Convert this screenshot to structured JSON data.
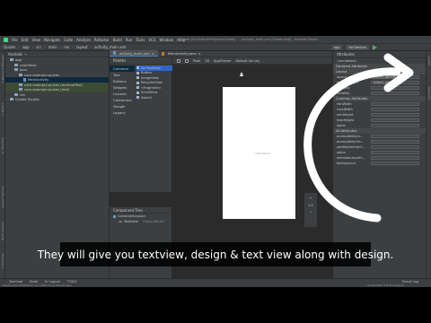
{
  "menubar": {
    "items": [
      "File",
      "Edit",
      "View",
      "Navigate",
      "Code",
      "Analyze",
      "Refactor",
      "Build",
      "Run",
      "Tools",
      "VCS",
      "Window",
      "Help"
    ],
    "window_title": "Quizes [D:\\Android Projects\\Quizes] - ...\\activity_main.xml [Quizes.app] - Android Studio"
  },
  "navbar": {
    "crumbs": [
      "Quizes",
      "app",
      "src",
      "main",
      "res",
      "layout",
      "activity_main.xml"
    ],
    "run_config": "app",
    "device": "No Devices",
    "zoom_value": "",
    "app_theme": "AppTheme",
    "default_label": "Default (en-us)"
  },
  "project": {
    "title": "Android",
    "rows": [
      {
        "label": "app",
        "indent": 1,
        "kind": "folder"
      },
      {
        "label": "manifests",
        "indent": 2,
        "kind": "folder"
      },
      {
        "label": "java",
        "indent": 2,
        "kind": "folder"
      },
      {
        "label": "com.example.quizes",
        "indent": 3,
        "kind": "folder"
      },
      {
        "label": "MainActivity",
        "indent": 4,
        "kind": "file",
        "selected": true
      },
      {
        "label": "com.example.quizes (androidTest)",
        "indent": 3,
        "kind": "folder",
        "highlighted": true
      },
      {
        "label": "com.example.quizes (test)",
        "indent": 3,
        "kind": "folder",
        "highlighted": true
      },
      {
        "label": "res",
        "indent": 2,
        "kind": "folder"
      },
      {
        "label": "Gradle Scripts",
        "indent": 1,
        "kind": "folder"
      }
    ]
  },
  "left_tabs": [
    "1: Project",
    "2: Resource Manager",
    "Layout Captures",
    "Build Variants",
    "2: Favorites",
    "Z: Structure"
  ],
  "right_tabs": [
    "Gradle",
    "Attributes"
  ],
  "editor_tabs": [
    {
      "label": "activity_main.xml",
      "active": true
    },
    {
      "label": "MainActivity.java",
      "active": false
    }
  ],
  "palette": {
    "title": "Palette",
    "categories": [
      "Common",
      "Text",
      "Buttons",
      "Widgets",
      "Layouts",
      "Containers",
      "Google",
      "Legacy"
    ],
    "items": [
      "Ab TextView",
      "Button",
      "ImageView",
      "RecyclerView",
      "<fragment>",
      "ScrollView",
      "Switch"
    ]
  },
  "component_tree": {
    "title": "Component Tree",
    "root": "ConstraintLayout",
    "child": "TextView",
    "child_value": "\"Hello World!\""
  },
  "designer": {
    "toolbar": [
      "Pixel",
      "28",
      "AppTheme",
      "Default (en-us)"
    ],
    "zoom_in": "+",
    "zoom_level": "1:1",
    "zoom_out": "−"
  },
  "attributes": {
    "title": "Attributes",
    "selected": "<unnamed>",
    "sections": {
      "declared": "Declared Attributes",
      "layout": "Layout",
      "common": "Common Attributes",
      "all": "All Attributes"
    },
    "layout_rows": [
      {
        "k": "layout_width",
        "v": "match_parent"
      },
      {
        "k": "layout_height",
        "v": "match_parent"
      },
      {
        "k": "visibility",
        "v": ""
      },
      {
        "k": "visibility",
        "v": ""
      }
    ],
    "common_rows": [
      "minWidth",
      "maxWidth",
      "minHeight",
      "maxHeight",
      "alpha"
    ],
    "all_rows": [
      "accessibilityLiv...",
      "accessibilityTra...",
      "addStatesFromC...",
      "alpha",
      "animateLayoutC...",
      "background"
    ]
  },
  "bottom_tools": {
    "items": [
      "Terminal",
      "Build",
      "6: Logcat",
      "TODO"
    ],
    "right": [
      "Event Log",
      "Layout Inspector"
    ]
  },
  "status": {
    "left": "Gradle sync finished in 14 s 400 ms (a minute ago)",
    "right": "19:26   CRLF   UTF-8   4 spaces"
  },
  "caption": "They will give you textview, design & text view along with design.",
  "colors": {
    "bg": "#2b2b2b",
    "panel": "#3c3f41",
    "accent": "#2f65ca",
    "selected": "#0d293e"
  }
}
